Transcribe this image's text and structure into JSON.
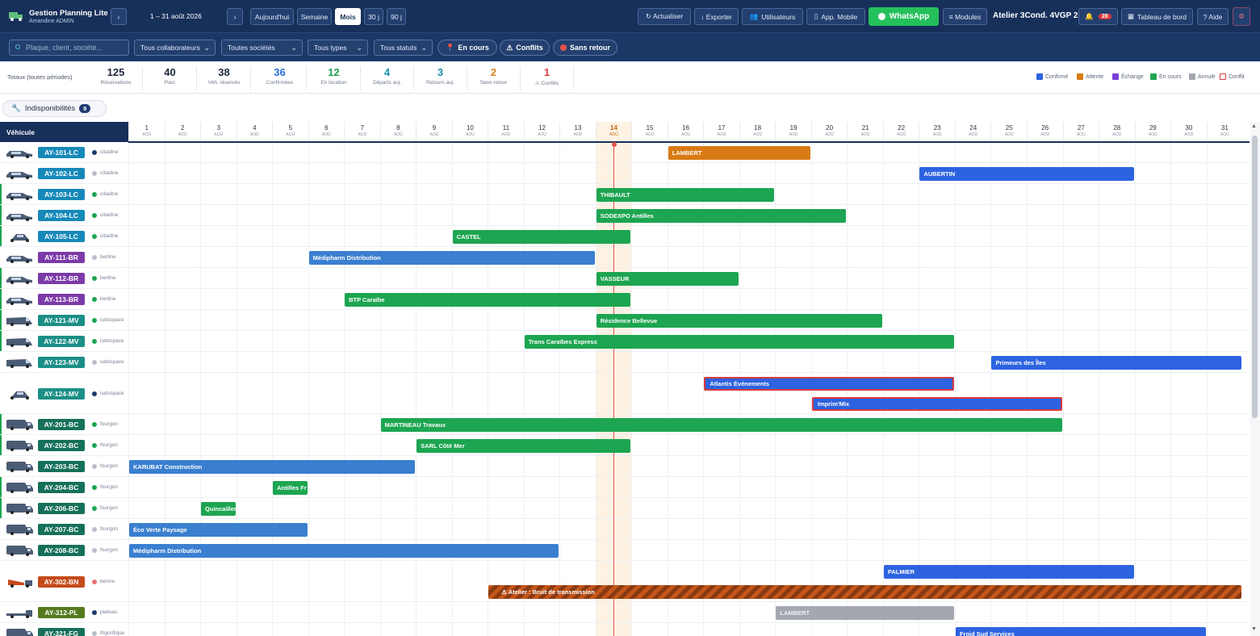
{
  "app": {
    "title": "Gestion Planning Lite",
    "user": "Amandine ADMIN",
    "period": "1 – 31 août 2026",
    "prev": "‹",
    "next": "›",
    "atelier": "Atelier 3Cond. 4VGP 2",
    "notif_count": "28"
  },
  "toolbar": {
    "today": "Aujourd'hui",
    "week": "Semaine",
    "month": "Mois",
    "d30": "30 j",
    "d90": "90 j",
    "refresh": "↻ Actualiser",
    "export": "↓ Exporter",
    "users": "Utilisateurs",
    "mobile": "App. Mobile",
    "whatsapp": "WhatsApp",
    "modules": "≡ Modules",
    "dashboard": "Tableau de bord",
    "help": "? Aide",
    "settings_icon": "⚙"
  },
  "filters": {
    "search_placeholder": "Plaque, client, société...",
    "collab": "Tous collaborateurs",
    "societes": "Toutes sociétés",
    "types": "Tous types",
    "statuts": "Tous statuts",
    "encours": "En cours",
    "conflits": "Conflits",
    "sansretour": "Sans retour"
  },
  "stats": {
    "label": "Totaux (toutes périodes)",
    "items": [
      {
        "value": "125",
        "label": "Réservations",
        "color": "#1e2a3b"
      },
      {
        "value": "40",
        "label": "Parc",
        "color": "#1e2a3b"
      },
      {
        "value": "38",
        "label": "Véh. réservés",
        "color": "#1e2a3b"
      },
      {
        "value": "36",
        "label": "Confirmées",
        "color": "#2a6fd6"
      },
      {
        "value": "12",
        "label": "En location",
        "color": "#1da551"
      },
      {
        "value": "4",
        "label": "Départs auj.",
        "color": "#1b8fa8"
      },
      {
        "value": "3",
        "label": "Retours auj.",
        "color": "#1b8fa8"
      },
      {
        "value": "2",
        "label": "Sans retour",
        "color": "#d9801c"
      },
      {
        "value": "1",
        "label": "⚠ Conflits",
        "color": "#d93a3a"
      }
    ]
  },
  "legend": [
    {
      "label": "Confirmé",
      "color": "#2d63e0",
      "outline": false
    },
    {
      "label": "Attente",
      "color": "#d97a14",
      "outline": false
    },
    {
      "label": "Échange",
      "color": "#7b3fd1",
      "outline": false
    },
    {
      "label": "En cours",
      "color": "#1da551",
      "outline": false
    },
    {
      "label": "Annulé",
      "color": "#a3a8b0",
      "outline": false
    },
    {
      "label": "Conflit",
      "color": "#d93a3a",
      "outline": true
    }
  ],
  "indispo": {
    "label": "Indisponibilités",
    "count": "9"
  },
  "grid": {
    "vehicle_header": "Véhicule",
    "month_abbr": "AOÛ",
    "days": [
      1,
      2,
      3,
      4,
      5,
      6,
      7,
      8,
      9,
      10,
      11,
      12,
      13,
      14,
      15,
      16,
      17,
      18,
      19,
      20,
      21,
      22,
      23,
      24,
      25,
      26,
      27,
      28,
      29,
      30,
      31
    ],
    "today": 14
  },
  "vehicles": [
    {
      "plate": "AY-101-LC",
      "type": "citadine",
      "plate_color": "#1689b8",
      "status": "#1c3a6e",
      "shape": "sedan",
      "bar": false
    },
    {
      "plate": "AY-102-LC",
      "type": "citadine",
      "plate_color": "#1689b8",
      "status": "#b8bfc9",
      "shape": "sedan",
      "bar": false
    },
    {
      "plate": "AY-103-LC",
      "type": "citadine",
      "plate_color": "#1689b8",
      "status": "#1da551",
      "shape": "sedan",
      "bar": true
    },
    {
      "plate": "AY-104-LC",
      "type": "citadine",
      "plate_color": "#1689b8",
      "status": "#1da551",
      "shape": "sedan",
      "bar": true
    },
    {
      "plate": "AY-105-LC",
      "type": "citadine",
      "plate_color": "#1689b8",
      "status": "#1da551",
      "shape": "small",
      "bar": true
    },
    {
      "plate": "AY-111-BR",
      "type": "berline",
      "plate_color": "#7b3aa8",
      "status": "#b8bfc9",
      "shape": "sedan",
      "bar": false
    },
    {
      "plate": "AY-112-BR",
      "type": "berline",
      "plate_color": "#7b3aa8",
      "status": "#1da551",
      "shape": "sedan",
      "bar": true
    },
    {
      "plate": "AY-113-BR",
      "type": "berline",
      "plate_color": "#7b3aa8",
      "status": "#1da551",
      "shape": "sedan",
      "bar": true
    },
    {
      "plate": "AY-121-MV",
      "type": "ludospace",
      "plate_color": "#1b8f86",
      "status": "#1da551",
      "shape": "van",
      "bar": true
    },
    {
      "plate": "AY-122-MV",
      "type": "ludospace",
      "plate_color": "#1b8f86",
      "status": "#1da551",
      "shape": "van",
      "bar": true
    },
    {
      "plate": "AY-123-MV",
      "type": "ludospace",
      "plate_color": "#1b8f86",
      "status": "#b8bfc9",
      "shape": "van",
      "bar": false
    },
    {
      "plate": "AY-124-MV",
      "type": "ludospace",
      "plate_color": "#1b8f86",
      "status": "#1c3a6e",
      "shape": "small",
      "bar": false
    },
    {
      "plate": "AY-201-BC",
      "type": "fourgon",
      "plate_color": "#16705a",
      "status": "#1da551",
      "shape": "truck",
      "bar": true
    },
    {
      "plate": "AY-202-BC",
      "type": "fourgon",
      "plate_color": "#16705a",
      "status": "#1da551",
      "shape": "truck",
      "bar": true
    },
    {
      "plate": "AY-203-BC",
      "type": "fourgon",
      "plate_color": "#16705a",
      "status": "#b8bfc9",
      "shape": "truck",
      "bar": false
    },
    {
      "plate": "AY-204-BC",
      "type": "fourgon",
      "plate_color": "#16705a",
      "status": "#1da551",
      "shape": "truck",
      "bar": true
    },
    {
      "plate": "AY-206-BC",
      "type": "fourgon",
      "plate_color": "#16705a",
      "status": "#1da551",
      "shape": "truck",
      "bar": true
    },
    {
      "plate": "AY-207-BC",
      "type": "fourgon",
      "plate_color": "#16705a",
      "status": "#b8bfc9",
      "shape": "truck",
      "bar": false
    },
    {
      "plate": "AY-208-BC",
      "type": "fourgon",
      "plate_color": "#16705a",
      "status": "#b8bfc9",
      "shape": "truck",
      "bar": false
    },
    {
      "plate": "AY-302-BN",
      "type": "benne",
      "plate_color": "#c44a1a",
      "status": "#e57373",
      "shape": "dump",
      "bar": false
    },
    {
      "plate": "AY-312-PL",
      "type": "plateau",
      "plate_color": "#557a1e",
      "status": "#1c3a6e",
      "shape": "flat",
      "bar": false
    },
    {
      "plate": "AY-321-FG",
      "type": "frigorifique",
      "plate_color": "#16705a",
      "status": "#b8bfc9",
      "shape": "truck",
      "bar": false
    }
  ],
  "bookings": [
    {
      "row": 0,
      "start": 16,
      "end": 19,
      "label": "LAMBERT",
      "status": "attente",
      "lane": 0
    },
    {
      "row": 1,
      "start": 23,
      "end": 28,
      "label": "AUBERTIN",
      "status": "confirme",
      "lane": 0
    },
    {
      "row": 2,
      "start": 14,
      "end": 18,
      "label": "THIBAULT",
      "status": "encours",
      "lane": 0
    },
    {
      "row": 3,
      "start": 14,
      "end": 20,
      "label": "SODEXPO Antilles",
      "status": "encours",
      "lane": 0
    },
    {
      "row": 4,
      "start": 10,
      "end": 14,
      "label": "CASTEL",
      "status": "encours",
      "lane": 0
    },
    {
      "row": 5,
      "start": 6,
      "end": 13,
      "label": "Médipharm Distribution",
      "status": "termine",
      "lane": 0
    },
    {
      "row": 6,
      "start": 14,
      "end": 17,
      "label": "VASSEUR",
      "status": "encours",
      "lane": 0
    },
    {
      "row": 7,
      "start": 7,
      "end": 14,
      "label": "BTP Caraïbe",
      "status": "encours",
      "lane": 0
    },
    {
      "row": 8,
      "start": 14,
      "end": 21,
      "label": "Résidence Bellevue",
      "status": "encours",
      "lane": 0
    },
    {
      "row": 9,
      "start": 12,
      "end": 23,
      "label": "Trans Caraïbes Express",
      "status": "encours",
      "lane": 0
    },
    {
      "row": 10,
      "start": 25,
      "end": 31,
      "label": "Primeurs des Îles",
      "status": "confirme",
      "lane": 0
    },
    {
      "row": 11,
      "start": 17,
      "end": 23,
      "label": "Atlantis Événements",
      "status": "conflit",
      "lane": 0
    },
    {
      "row": 11,
      "start": 20,
      "end": 26,
      "label": "Imprim'Mix",
      "status": "conflit",
      "lane": 1
    },
    {
      "row": 12,
      "start": 8,
      "end": 26,
      "label": "MARTINEAU Travaux",
      "status": "encours",
      "lane": 0
    },
    {
      "row": 13,
      "start": 9,
      "end": 14,
      "label": "SARL Côté Mer",
      "status": "encours",
      "lane": 0
    },
    {
      "row": 14,
      "start": 1,
      "end": 8,
      "label": "KARUBAT Construction",
      "status": "termine",
      "lane": 0
    },
    {
      "row": 15,
      "start": 5,
      "end": 5,
      "label": "Antilles Fr",
      "status": "encours",
      "lane": 0
    },
    {
      "row": 16,
      "start": 3,
      "end": 3,
      "label": "Quincailler",
      "status": "encours",
      "lane": 0
    },
    {
      "row": 17,
      "start": 1,
      "end": 5,
      "label": "Éco Verte Paysage",
      "status": "termine",
      "lane": 0
    },
    {
      "row": 18,
      "start": 1,
      "end": 12,
      "label": "Médipharm Distribution",
      "status": "termine",
      "lane": 0
    },
    {
      "row": 19,
      "start": 22,
      "end": 28,
      "label": "PALMIER",
      "status": "confirme",
      "lane": 0
    },
    {
      "row": 19,
      "start": 11,
      "end": 31,
      "label": "⚠ Atelier : Bruit de transmission",
      "status": "atelier",
      "lane": 1
    },
    {
      "row": 20,
      "start": 19,
      "end": 23,
      "label": "LAMBERT",
      "status": "annule",
      "lane": 0
    },
    {
      "row": 21,
      "start": 24,
      "end": 30,
      "label": "Froid Sud Services",
      "status": "confirme",
      "lane": 0
    }
  ],
  "status_colors": {
    "confirme": "#2d63e0",
    "attente": "#d97a14",
    "encours": "#1da551",
    "termine": "#3a7fd0",
    "conflit": "#2d63e0",
    "annule": "#a3a8b0",
    "atelier": "#c4561a"
  }
}
